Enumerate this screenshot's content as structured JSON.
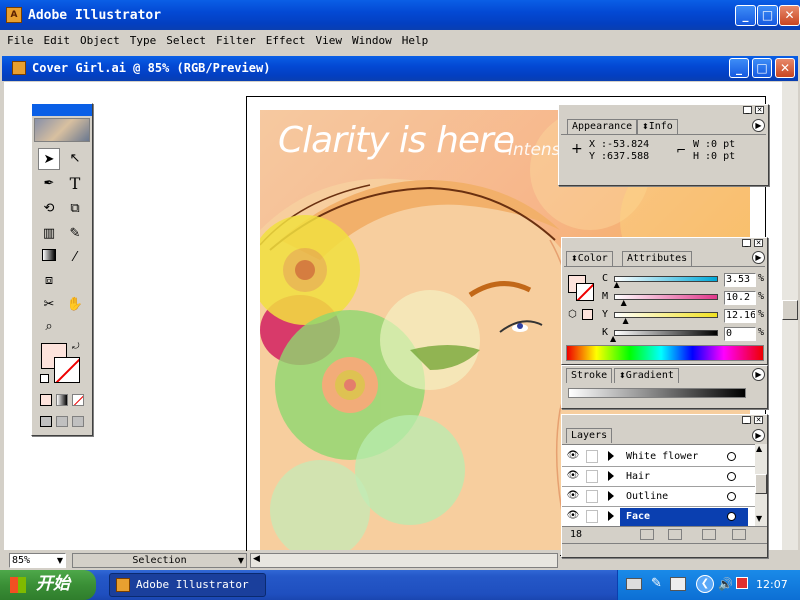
{
  "app": {
    "title": "Adobe Illustrator"
  },
  "menu": [
    "File",
    "Edit",
    "Object",
    "Type",
    "Select",
    "Filter",
    "Effect",
    "View",
    "Window",
    "Help"
  ],
  "document": {
    "title": "Cover Girl.ai @ 85% (RGB/Preview)"
  },
  "artwork": {
    "headline": "Clarity is here",
    "subline": "Intens"
  },
  "status": {
    "zoom": "85%",
    "tool": "Selection"
  },
  "info_panel": {
    "tabs": [
      "Appearance",
      "Info"
    ],
    "x": "X :-53.824",
    "y": "Y :637.588",
    "w": "W :0 pt",
    "h": "H :0 pt"
  },
  "color_panel": {
    "tabs": [
      "Color",
      "Attributes"
    ],
    "channels": [
      {
        "label": "C",
        "value": "3.53",
        "unit": "%",
        "level": 0.035,
        "grad": "linear-gradient(90deg,#fff,#00a8d8)"
      },
      {
        "label": "M",
        "value": "10.2",
        "unit": "%",
        "level": 0.102,
        "grad": "linear-gradient(90deg,#fff,#e0388a)"
      },
      {
        "label": "Y",
        "value": "12.16",
        "unit": "%",
        "level": 0.12,
        "grad": "linear-gradient(90deg,#fff,#f0e020)"
      },
      {
        "label": "K",
        "value": "0",
        "unit": "%",
        "level": 0.0,
        "grad": "linear-gradient(90deg,#fff,#000)"
      }
    ],
    "fill_color": "#fde3dc"
  },
  "stroke_panel": {
    "tabs": [
      "Stroke",
      "Gradient"
    ]
  },
  "layers_panel": {
    "tab": "Layers",
    "layers": [
      "White flower",
      "Hair",
      "Outline",
      "Face"
    ],
    "selected": "Face",
    "count": "18"
  },
  "taskbar": {
    "start": "开始",
    "app": "Adobe Illustrator",
    "clock": "12:07"
  },
  "colors": {
    "accent": "#0a5fe6",
    "selection": "#0a3fb0"
  }
}
